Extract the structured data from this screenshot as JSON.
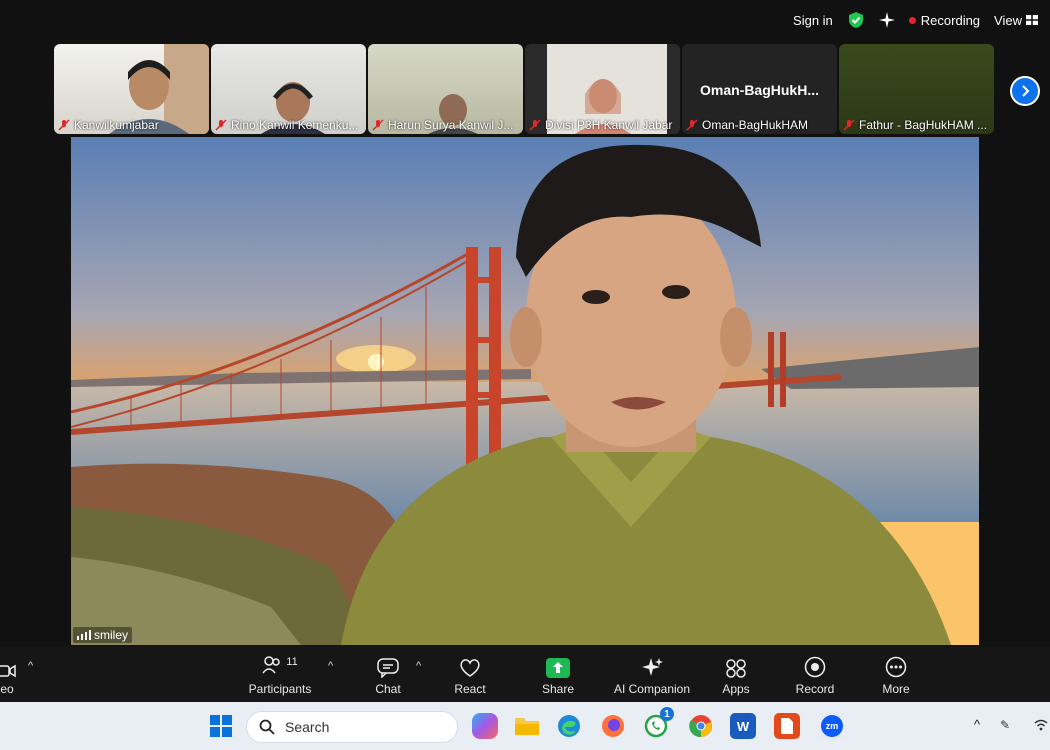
{
  "topbar": {
    "signin_label": "Sign in",
    "recording_label": "Recording",
    "view_label": "View"
  },
  "participants_strip": [
    {
      "name": "Kanwilkumjabar"
    },
    {
      "name": "Rino Kanwil Kemenku..."
    },
    {
      "name": "Harun Surya Kanwil J..."
    },
    {
      "name": "Divisi P3H Kanwil Jabar"
    },
    {
      "name": "Oman-BagHukHAM",
      "display_name": "Oman-BagHukH..."
    },
    {
      "name": "Fathur - BagHukHAM ..."
    }
  ],
  "speaker": {
    "name": "smiley"
  },
  "toolbar": {
    "video_label": "eo",
    "participants_label": "Participants",
    "participants_count": "11",
    "chat_label": "Chat",
    "react_label": "React",
    "share_label": "Share",
    "ai_label": "AI Companion",
    "apps_label": "Apps",
    "record_label": "Record",
    "more_label": "More"
  },
  "taskbar": {
    "search_placeholder": "Search",
    "whatsapp_badge": "1",
    "zoom_label": "zm"
  },
  "colors": {
    "accent_blue": "#0e72ed",
    "share_green": "#1db954",
    "recording_red": "#e02828"
  }
}
